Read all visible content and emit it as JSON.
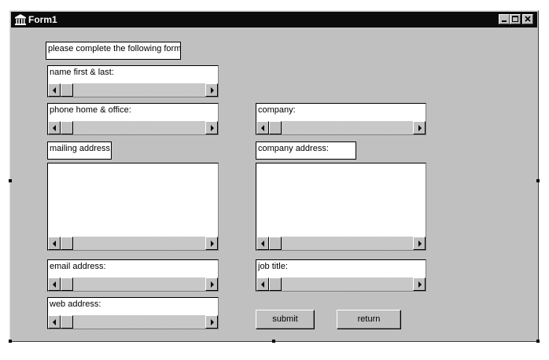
{
  "window": {
    "title": "Form1",
    "icon": "bank-icon"
  },
  "titlebar_buttons": [
    "minimize-icon",
    "maximize-icon",
    "close-icon"
  ],
  "form": {
    "instructions": "please complete the following form",
    "fields": {
      "name": "name first & last:",
      "phone": "phone home & office:",
      "company": "company:",
      "mailing_address": "mailing address:",
      "company_address": "company address:",
      "email": "email address:",
      "job_title": "job title:",
      "web_address": "web address:"
    },
    "buttons": {
      "submit": "submit",
      "return": "return"
    }
  }
}
